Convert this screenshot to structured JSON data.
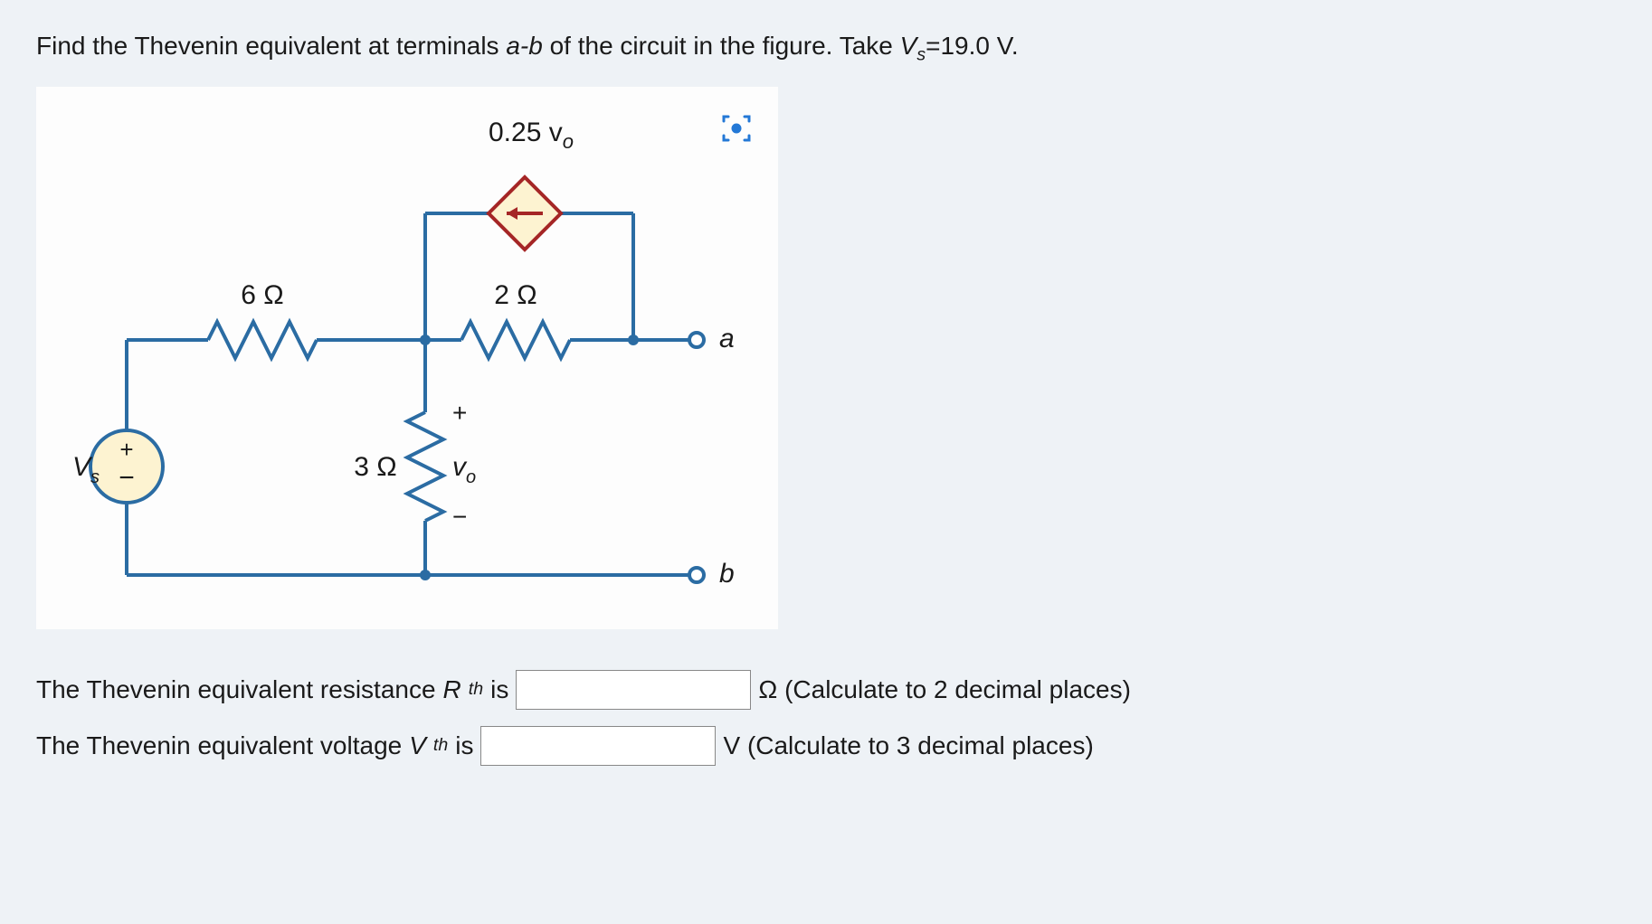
{
  "question": {
    "prefix": "Find the Thevenin equivalent at terminals ",
    "terminals": "a-b",
    "middle": " of the circuit in the figure. Take ",
    "vs_label": "V",
    "vs_sub": "s",
    "vs_eq": "=19.0 V."
  },
  "circuit": {
    "dep_source_label": "0.25 v",
    "dep_source_sub": "o",
    "r1_label": "6 Ω",
    "r2_label": "2 Ω",
    "r3_label": "3 Ω",
    "vo_plus": "+",
    "vo_label": "v",
    "vo_sub": "o",
    "vo_minus": "−",
    "vs_symbol": "V",
    "vs_sub": "s",
    "vs_plus": "+",
    "vs_minus": "−",
    "term_a": "a",
    "term_b": "b"
  },
  "answers": {
    "rth_prefix": "The Thevenin equivalent resistance ",
    "rth_sym": "R",
    "rth_sub": "th",
    "rth_is": " is",
    "rth_unit": "Ω (Calculate to 2 decimal places)",
    "vth_prefix": "The Thevenin equivalent voltage ",
    "vth_sym": "V",
    "vth_sub": "th",
    "vth_is": " is",
    "vth_unit": "V (Calculate to 3 decimal places)"
  }
}
